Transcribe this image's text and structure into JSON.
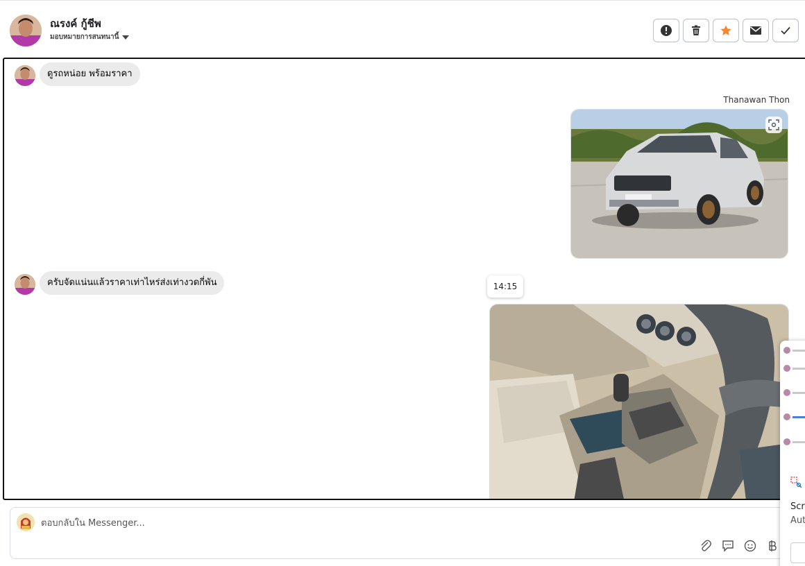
{
  "header": {
    "contact_name": "ณรงค์ กู้ชีพ",
    "assign_label": "มอบหมายการสนทนานี้",
    "actions": [
      "spam-icon",
      "trash-icon",
      "star-icon",
      "mail-icon",
      "check-icon"
    ]
  },
  "chat": {
    "messages": [
      {
        "from": "customer",
        "text": "ดูรถหน่อย  พร้อมราคา"
      },
      {
        "from": "page",
        "sender": "Thanawan Thon",
        "type": "image",
        "content": "silver pickup truck photo"
      },
      {
        "from": "customer",
        "text": "ครับจัดแน่นแล้วราคาเท่าไหร่ส่งเท่างวดกี่พัน"
      },
      {
        "from": "page",
        "type": "image",
        "content": "car interior gear shift photo"
      }
    ],
    "time_tooltip": "14:15"
  },
  "composer": {
    "placeholder": "ตอบกลับใน Messenger...",
    "tools": [
      "attach-icon",
      "saved-reply-icon",
      "emoji-icon",
      "baht-icon"
    ]
  },
  "popup": {
    "title_partial": "Scre",
    "subtitle_partial": "Aut"
  },
  "colors": {
    "accent_star": "#f5862e",
    "bubble_bg": "#ebebeb",
    "border_focus": "#111111"
  }
}
